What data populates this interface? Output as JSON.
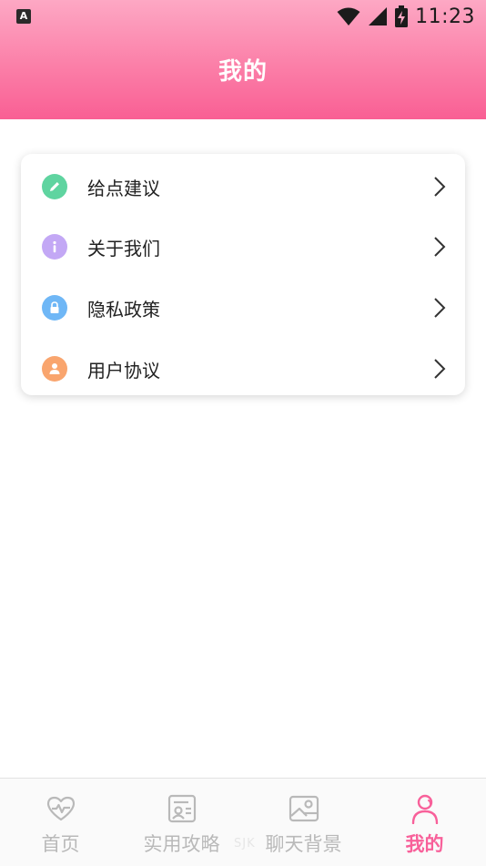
{
  "status_bar": {
    "time": "11:23",
    "app_icon": "A"
  },
  "header": {
    "title": "我的"
  },
  "menu": {
    "items": [
      {
        "label": "给点建议",
        "icon": "pencil-icon",
        "icon_color": "#5fd4a0"
      },
      {
        "label": "关于我们",
        "icon": "info-icon",
        "icon_color": "#c3a8f5"
      },
      {
        "label": "隐私政策",
        "icon": "lock-icon",
        "icon_color": "#6fb7f6"
      },
      {
        "label": "用户协议",
        "icon": "user-icon",
        "icon_color": "#f9a56e"
      }
    ]
  },
  "tabbar": {
    "tabs": [
      {
        "label": "首页",
        "icon": "heartbeat-icon"
      },
      {
        "label": "实用攻略",
        "icon": "guide-icon"
      },
      {
        "label": "聊天背景",
        "icon": "image-icon"
      },
      {
        "label": "我的",
        "icon": "person-icon"
      }
    ],
    "active": "我的",
    "active_color": "#f8609a",
    "inactive_color": "#b9b9b9"
  },
  "watermark": "SJK",
  "theme": {
    "header_top": "#fda8c4",
    "header_bottom": "#f95f94"
  }
}
